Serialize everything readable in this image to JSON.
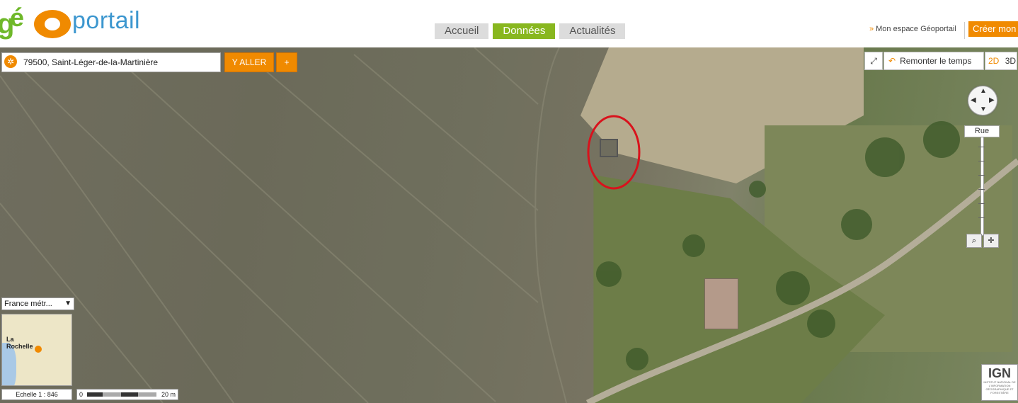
{
  "header": {
    "logo_letters": "géo",
    "logo_text": "portail",
    "tabs": [
      {
        "label": "Accueil",
        "active": false
      },
      {
        "label": "Données",
        "active": true
      },
      {
        "label": "Actualités",
        "active": false
      }
    ],
    "espace_label": "Mon espace Géoportail",
    "espace_chevron": "»",
    "creer_label": "Créer mon"
  },
  "map": {
    "search_value": "79500, Saint-Léger-de-la-Martinière",
    "go_button": "Y ALLER",
    "plus_button": "+",
    "fullscreen_icon": "fullscreen-icon",
    "time_button": "Remonter le temps",
    "view_2d": "2D",
    "view_3d": "3D",
    "zoom_label": "Rue",
    "minimap_select": "France métr...",
    "minimap_city": "La\nRochelle",
    "scale_text": "Echelle 1 :  846",
    "scale_start": "0",
    "scale_end": "20 m",
    "ign_title": "IGN",
    "ign_subtitle": "INSTITUT NATIONAL DE L'INFORMATION GÉOGRAPHIQUE ET FORESTIÈRE",
    "annotation_color": "#d9121c",
    "accent_color": "#f08a00"
  }
}
